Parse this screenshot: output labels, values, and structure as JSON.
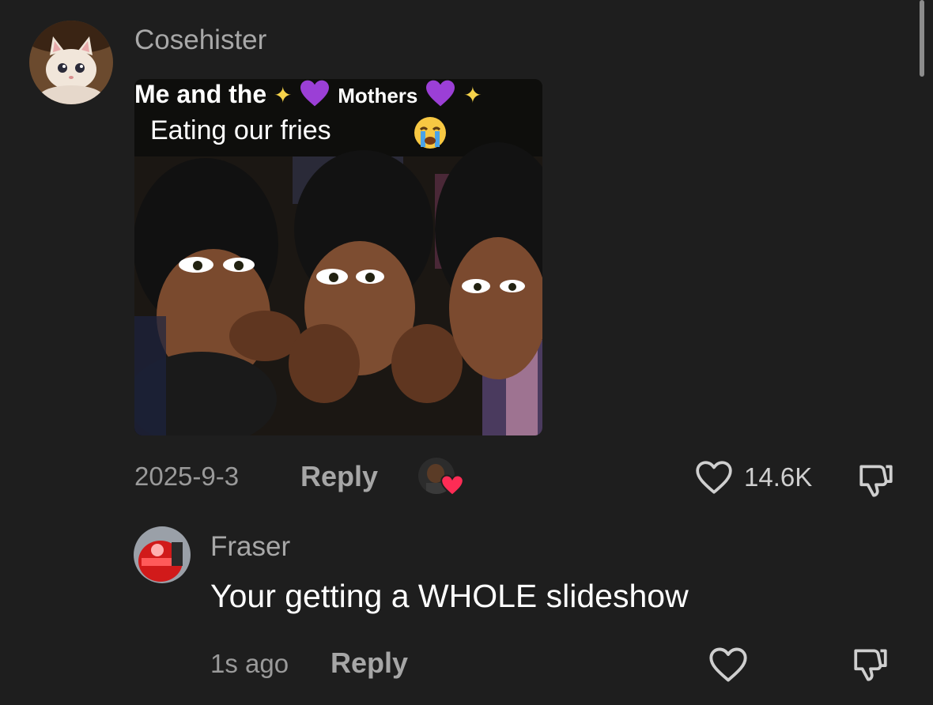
{
  "comments": [
    {
      "username": "Cosehister",
      "media": {
        "caption_line1": [
          "Me and the",
          "Mothers"
        ],
        "caption_line2": "Eating our fries",
        "emojis": [
          "sparkles-icon",
          "purple-heart-icon",
          "loudly-crying-face-icon"
        ]
      },
      "date": "2025-9-3",
      "reply_label": "Reply",
      "likes": "14.6K"
    },
    {
      "username": "Fraser",
      "text": "Your getting a WHOLE slideshow",
      "time": "1s ago",
      "reply_label": "Reply"
    }
  ],
  "colors": {
    "background": "#1e1e1e",
    "username": "#a8a8a8",
    "meta": "#9a9a9a",
    "reply": "#a6a6a6",
    "liked_badge": "#fe2c55"
  }
}
